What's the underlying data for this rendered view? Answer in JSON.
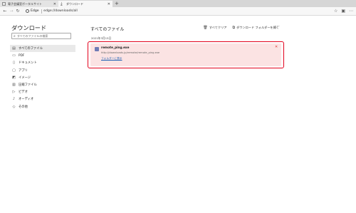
{
  "tabs": [
    {
      "title": "電子会議室ポータルサイト",
      "icon": "page-icon",
      "active": false
    },
    {
      "title": "ダウンロード",
      "icon": "download-icon",
      "active": true
    }
  ],
  "address": {
    "browser_label": "Edge",
    "url": "edge://downloads/all"
  },
  "sidebar": {
    "title": "ダウンロード",
    "search_placeholder": "すべてのファイルの検索",
    "items": [
      {
        "label": "すべてのファイル",
        "icon": "all-files-icon",
        "selected": true
      },
      {
        "label": "PDF",
        "icon": "pdf-icon",
        "selected": false
      },
      {
        "label": "ドキュメント",
        "icon": "document-icon",
        "selected": false
      },
      {
        "label": "アプリ",
        "icon": "app-icon",
        "selected": false
      },
      {
        "label": "イメージ",
        "icon": "image-icon",
        "selected": false
      },
      {
        "label": "圧縮ファイル",
        "icon": "archive-icon",
        "selected": false
      },
      {
        "label": "ビデオ",
        "icon": "video-icon",
        "selected": false
      },
      {
        "label": "オーディオ",
        "icon": "audio-icon",
        "selected": false
      },
      {
        "label": "その他",
        "icon": "other-icon",
        "selected": false
      }
    ]
  },
  "main": {
    "title": "すべてのファイル",
    "clear_all": "すべてクリア",
    "open_folder": "ダウンロード フォルダーを開く",
    "more": "···",
    "date": "2021年3月15日",
    "download": {
      "filename": "remote_ping.exe",
      "url": "http://downloads.jp/remote/remote_ping.exe",
      "action": "フォルダーに表示"
    }
  },
  "colors": {
    "highlight": "#e3001b",
    "card_bg": "#fbe3e3",
    "link": "#1a5fb4"
  }
}
